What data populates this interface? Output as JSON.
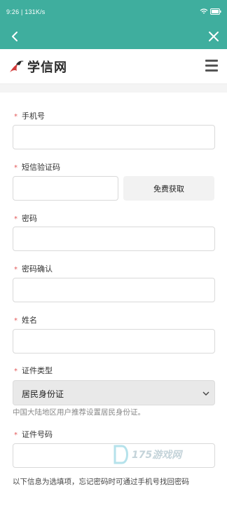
{
  "status_bar": {
    "time_text": "9:26 | 131K/s",
    "right_text": "Wi-Fi 92"
  },
  "header": {
    "brand": "学信网"
  },
  "form": {
    "phone_label": "手机号",
    "sms_label": "短信验证码",
    "get_code_label": "免费获取",
    "password_label": "密码",
    "confirm_label": "密码确认",
    "name_label": "姓名",
    "id_type_label": "证件类型",
    "id_type_value": "居民身份证",
    "id_type_hint": "中国大陆地区用户推荐设置居民身份证。",
    "id_number_label": "证件号码",
    "optional_note": "以下信息为选填项，忘记密码时可通过手机号找回密码"
  },
  "watermark_text": "175游戏网",
  "colors": {
    "nav": "#3fae9e",
    "required_star": "#e35a5a",
    "brand_red": "#d23b3b"
  }
}
